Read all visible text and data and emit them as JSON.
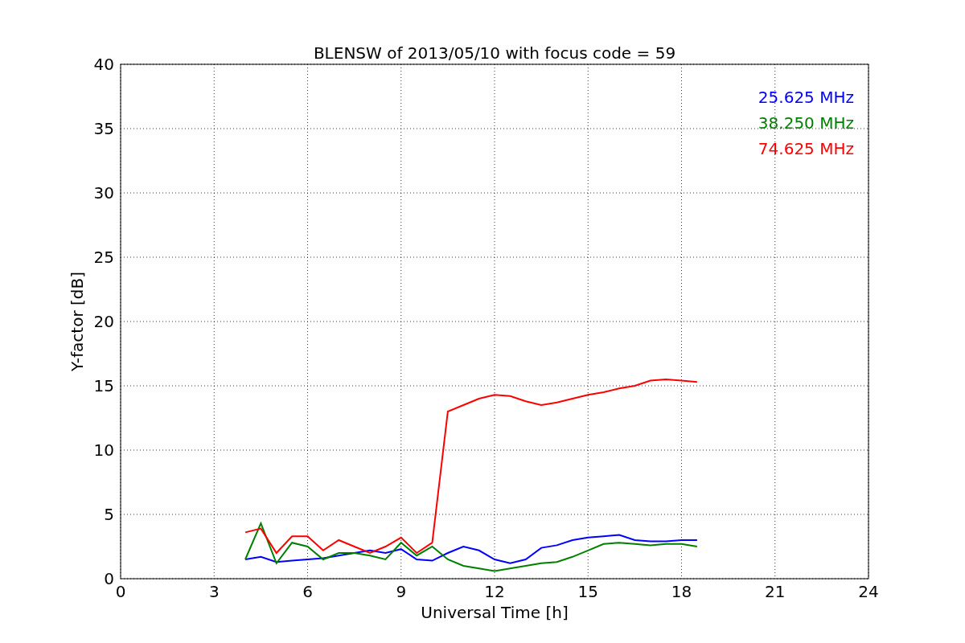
{
  "figure": {
    "chart_data": {
      "type": "line",
      "title": "BLENSW of 2013/05/10 with focus code = 59",
      "xlabel": "Universal Time [h]",
      "ylabel": "Y-factor [dB]",
      "x": [
        4,
        4.5,
        5,
        5.5,
        6,
        6.5,
        7,
        7.5,
        8,
        8.5,
        9,
        9.5,
        10,
        10.5,
        11,
        11.5,
        12,
        12.5,
        13,
        13.5,
        14,
        14.5,
        15,
        15.5,
        16,
        16.5,
        17,
        17.5,
        18,
        18.5
      ],
      "series": [
        {
          "name": "25.625 MHz",
          "color": "#0000ff",
          "values": [
            1.5,
            1.7,
            1.3,
            1.4,
            1.5,
            1.6,
            1.8,
            2.0,
            2.2,
            2.0,
            2.3,
            1.5,
            1.4,
            2.0,
            2.5,
            2.2,
            1.5,
            1.2,
            1.5,
            2.4,
            2.6,
            3.0,
            3.2,
            3.3,
            3.4,
            3.0,
            2.9,
            2.9,
            3.0,
            3.0
          ]
        },
        {
          "name": "38.250 MHz",
          "color": "#008000",
          "values": [
            1.5,
            4.3,
            1.2,
            2.8,
            2.5,
            1.5,
            2.0,
            2.0,
            1.8,
            1.5,
            2.8,
            1.8,
            2.5,
            1.5,
            1.0,
            0.8,
            0.6,
            0.8,
            1.0,
            1.2,
            1.3,
            1.7,
            2.2,
            2.7,
            2.8,
            2.7,
            2.6,
            2.7,
            2.7,
            2.5
          ]
        },
        {
          "name": "74.625 MHz",
          "color": "#ff0000",
          "values": [
            3.6,
            3.9,
            2.0,
            3.3,
            3.3,
            2.2,
            3.0,
            2.5,
            2.0,
            2.5,
            3.2,
            2.0,
            2.8,
            13.0,
            13.5,
            14.0,
            14.3,
            14.2,
            13.8,
            13.5,
            13.7,
            14.0,
            14.3,
            14.5,
            14.8,
            15.0,
            15.4,
            15.5,
            15.4,
            15.3
          ]
        }
      ],
      "xlim": [
        0,
        24
      ],
      "ylim": [
        0,
        40
      ],
      "xticks": [
        0,
        3,
        6,
        9,
        12,
        15,
        18,
        21,
        24
      ],
      "yticks": [
        0,
        5,
        10,
        15,
        20,
        25,
        30,
        35,
        40
      ],
      "grid": true
    }
  }
}
